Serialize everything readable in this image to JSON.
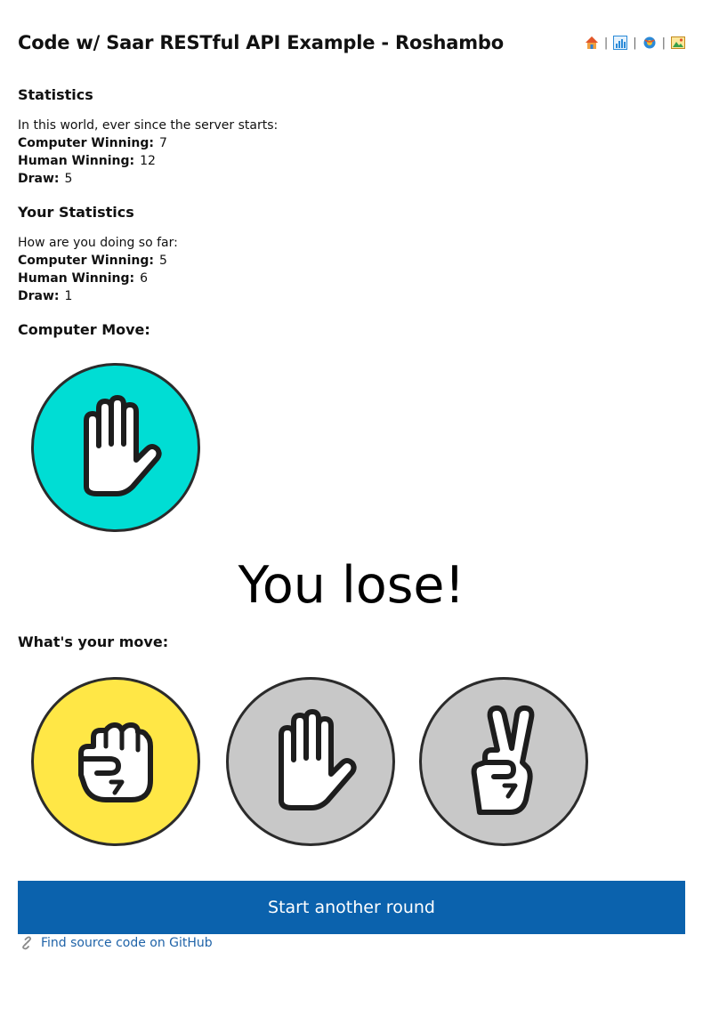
{
  "header": {
    "title": "Code w/ Saar RESTful API Example - Roshambo",
    "icons": [
      "home-icon",
      "chart-icon",
      "ball-icon",
      "picture-icon"
    ],
    "separator": "|"
  },
  "global_stats": {
    "heading": "Statistics",
    "intro": "In this world, ever since the server starts:",
    "computer_label": "Computer Winning:",
    "computer_value": "7",
    "human_label": "Human Winning:",
    "human_value": "12",
    "draw_label": "Draw:",
    "draw_value": "5"
  },
  "your_stats": {
    "heading": "Your Statistics",
    "intro": "How are you doing so far:",
    "computer_label": "Computer Winning:",
    "computer_value": "5",
    "human_label": "Human Winning:",
    "human_value": "6",
    "draw_label": "Draw:",
    "draw_value": "1"
  },
  "computer_move": {
    "heading": "Computer Move:",
    "move": "paper",
    "color": "#00ddd4"
  },
  "result": "You lose!",
  "your_move": {
    "heading": "What's your move:",
    "options": [
      {
        "move": "rock",
        "icon": "rock-hand-icon",
        "color": "#ffe746"
      },
      {
        "move": "paper",
        "icon": "paper-hand-icon",
        "color": "#c8c8c8"
      },
      {
        "move": "scissors",
        "icon": "scissors-hand-icon",
        "color": "#c8c8c8"
      }
    ]
  },
  "start_button": "Start another round",
  "github_link": "Find source code on GitHub",
  "colors": {
    "button": "#0b62ad",
    "link": "#1f63a8"
  }
}
